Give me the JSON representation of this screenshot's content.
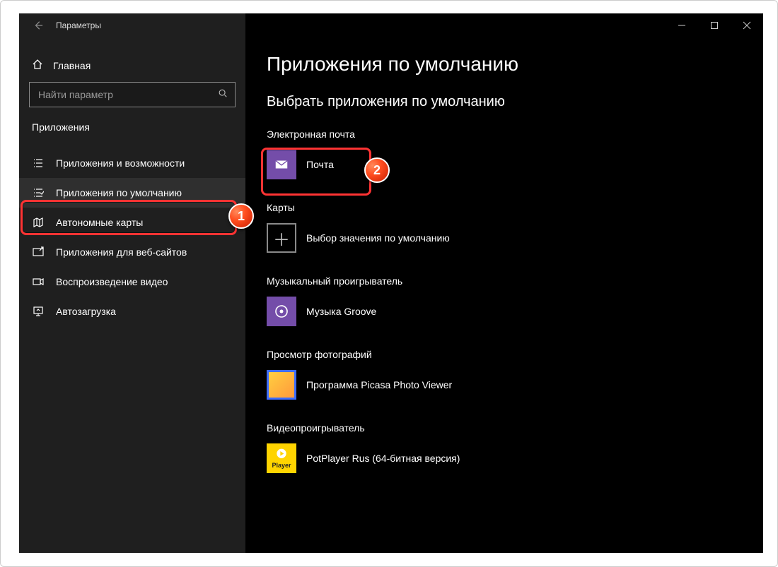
{
  "window": {
    "title": "Параметры"
  },
  "sidebar": {
    "home": "Главная",
    "search_placeholder": "Найти параметр",
    "section": "Приложения",
    "items": [
      {
        "label": "Приложения и возможности"
      },
      {
        "label": "Приложения по умолчанию"
      },
      {
        "label": "Автономные карты"
      },
      {
        "label": "Приложения для веб-сайтов"
      },
      {
        "label": "Воспроизведение видео"
      },
      {
        "label": "Автозагрузка"
      }
    ]
  },
  "main": {
    "title": "Приложения по умолчанию",
    "subtitle": "Выбрать приложения по умолчанию",
    "groups": {
      "email": {
        "label": "Электронная почта",
        "app": "Почта"
      },
      "maps": {
        "label": "Карты",
        "app": "Выбор значения по умолчанию"
      },
      "music": {
        "label": "Музыкальный проигрыватель",
        "app": "Музыка Groove"
      },
      "photos": {
        "label": "Просмотр фотографий",
        "app": "Программа Picasa Photo Viewer"
      },
      "video": {
        "label": "Видеопроигрыватель",
        "app": "PotPlayer Rus (64-битная версия)"
      }
    }
  },
  "annotations": {
    "one": "1",
    "two": "2"
  },
  "colors": {
    "accent": "#744da9",
    "highlight": "#ff3333"
  }
}
